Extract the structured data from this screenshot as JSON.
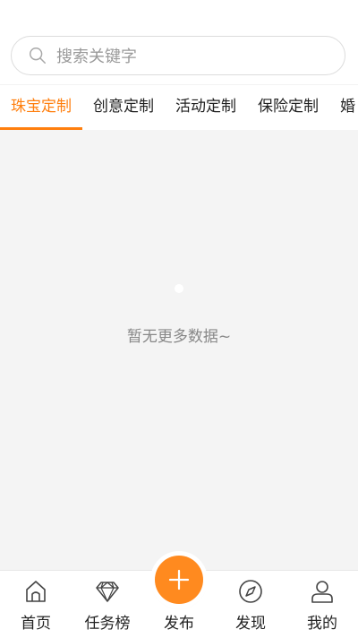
{
  "search": {
    "placeholder": "搜索关键字"
  },
  "tabs": [
    {
      "label": "珠宝定制",
      "active": true
    },
    {
      "label": "创意定制",
      "active": false
    },
    {
      "label": "活动定制",
      "active": false
    },
    {
      "label": "保险定制",
      "active": false
    },
    {
      "label": "婚",
      "active": false
    }
  ],
  "content": {
    "empty_message": "暂无更多数据~"
  },
  "tabbar": {
    "items": [
      {
        "label": "首页",
        "icon": "home-icon"
      },
      {
        "label": "任务榜",
        "icon": "diamond-icon"
      },
      {
        "label": "发布",
        "icon": "plus-icon"
      },
      {
        "label": "发现",
        "icon": "compass-icon"
      },
      {
        "label": "我的",
        "icon": "user-icon"
      }
    ]
  },
  "colors": {
    "accent": "#ff7f0e",
    "publish_button": "#ff8a1f",
    "content_bg": "#f4f4f4"
  }
}
